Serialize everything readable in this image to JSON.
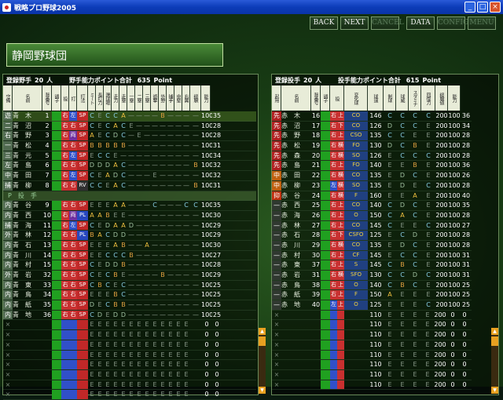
{
  "window": {
    "title": "戦略プロ野球2005"
  },
  "toolbar": {
    "back": "BACK",
    "next": "NEXT",
    "cancel": "CANCEL",
    "data": "DATA",
    "config": "CONFIG",
    "menu": "MENU"
  },
  "team": {
    "name": "静岡野球団"
  },
  "batters": {
    "label_registered": "登録野手",
    "count": "20",
    "unit": "人",
    "points_label": "野手能力ポイント合計",
    "points": "635",
    "points_unit": "Point",
    "headers": [
      "守備",
      "名前",
      "背番号",
      "調子",
      "投",
      "打",
      "打法",
      "ミート",
      "長打力",
      "選球眼",
      "走力",
      "走塁",
      "一塁",
      "二塁",
      "三塁",
      "遊撃",
      "外野",
      "捕手",
      "中堅",
      "右翼",
      "経験",
      "能力"
    ],
    "rows": [
      {
        "pos": "遊",
        "name": "青　木",
        "no": "1",
        "bat": "右",
        "hand": "左",
        "style": "SP",
        "g": [
          "C",
          "E",
          "C",
          "C",
          "A",
          "—",
          "—",
          "—",
          "—",
          "B",
          "—",
          "—",
          "—",
          "—"
        ],
        "exp": "100",
        "ab": "35"
      },
      {
        "pos": "二",
        "name": "青　沼",
        "no": "2",
        "bat": "右",
        "hand": "右",
        "style": "SP",
        "g": [
          "C",
          "E",
          "C",
          "A",
          "C",
          "E",
          "—",
          "—",
          "—",
          "—",
          "—",
          "—",
          "—",
          "—"
        ],
        "exp": "100",
        "ab": "28"
      },
      {
        "pos": "右",
        "name": "青　野",
        "no": "3",
        "bat": "右",
        "hand": "両",
        "style": "SP",
        "g": [
          "A",
          "E",
          "C",
          "D",
          "C",
          "—",
          "E",
          "—",
          "—",
          "—",
          "—",
          "—",
          "—",
          "—"
        ],
        "exp": "100",
        "ab": "28"
      },
      {
        "pos": "一",
        "name": "青　松",
        "no": "4",
        "bat": "右",
        "hand": "右",
        "style": "SP",
        "g": [
          "B",
          "B",
          "B",
          "B",
          "B",
          "—",
          "—",
          "—",
          "—",
          "—",
          "—",
          "—",
          "—",
          "—"
        ],
        "exp": "100",
        "ab": "31"
      },
      {
        "pos": "三",
        "name": "青　元",
        "no": "5",
        "bat": "右",
        "hand": "左",
        "style": "SP",
        "g": [
          "E",
          "C",
          "C",
          "E",
          "—",
          "—",
          "—",
          "—",
          "—",
          "—",
          "—",
          "—",
          "—",
          "—"
        ],
        "exp": "100",
        "ab": "34"
      },
      {
        "pos": "左",
        "name": "青　島",
        "no": "6",
        "bat": "右",
        "hand": "右",
        "style": "SP",
        "g": [
          "D",
          "D",
          "D",
          "A",
          "C",
          "—",
          "—",
          "—",
          "—",
          "—",
          "—",
          "—",
          "—",
          "B"
        ],
        "exp": "100",
        "ab": "32"
      },
      {
        "pos": "中",
        "name": "青　田",
        "no": "7",
        "bat": "右",
        "hand": "左",
        "style": "SP",
        "g": [
          "C",
          "E",
          "A",
          "D",
          "C",
          "—",
          "—",
          "—",
          "E",
          "—",
          "—",
          "—",
          "—",
          "—"
        ],
        "exp": "100",
        "ab": "32"
      },
      {
        "pos": "捕",
        "name": "青　柳",
        "no": "8",
        "bat": "右",
        "hand": "右",
        "style": "RV",
        "g": [
          "C",
          "C",
          "E",
          "A",
          "C",
          "—",
          "—",
          "—",
          "—",
          "—",
          "—",
          "—",
          "—",
          "B"
        ],
        "exp": "100",
        "ab": "31"
      },
      {
        "section": "P　投　手"
      },
      {
        "pos": "内",
        "name": "青　谷",
        "no": "9",
        "bat": "右",
        "hand": "右",
        "style": "SP",
        "g": [
          "E",
          "E",
          "E",
          "A",
          "A",
          "—",
          "—",
          "—",
          "C",
          "—",
          "—",
          "—",
          "C",
          "C"
        ],
        "exp": "100",
        "ab": "35"
      },
      {
        "pos": "内",
        "name": "青　西",
        "no": "10",
        "bat": "右",
        "hand": "両",
        "style": "PL",
        "g": [
          "A",
          "A",
          "B",
          "E",
          "E",
          "—",
          "—",
          "—",
          "—",
          "—",
          "—",
          "—",
          "—",
          "—"
        ],
        "exp": "100",
        "ab": "30"
      },
      {
        "pos": "捕",
        "name": "青　海",
        "no": "11",
        "bat": "右",
        "hand": "左",
        "style": "SP",
        "g": [
          "C",
          "E",
          "D",
          "A",
          "A",
          "D",
          "—",
          "—",
          "—",
          "—",
          "—",
          "—",
          "—",
          "—"
        ],
        "exp": "100",
        "ab": "29"
      },
      {
        "pos": "外",
        "name": "青　林",
        "no": "12",
        "bat": "右",
        "hand": "右",
        "style": "PL",
        "g": [
          "B",
          "A",
          "C",
          "D",
          "D",
          "—",
          "—",
          "—",
          "—",
          "—",
          "—",
          "—",
          "—",
          "—"
        ],
        "exp": "100",
        "ab": "29"
      },
      {
        "pos": "内",
        "name": "青　石",
        "no": "13",
        "bat": "右",
        "hand": "右",
        "style": "SP",
        "g": [
          "E",
          "E",
          "E",
          "A",
          "B",
          "—",
          "—",
          "A",
          "—",
          "—",
          "—",
          "—",
          "—",
          "—"
        ],
        "exp": "100",
        "ab": "30"
      },
      {
        "pos": "内",
        "name": "青　川",
        "no": "14",
        "bat": "右",
        "hand": "右",
        "style": "SP",
        "g": [
          "E",
          "E",
          "C",
          "C",
          "C",
          "B",
          "—",
          "—",
          "—",
          "—",
          "—",
          "—",
          "—",
          "—"
        ],
        "exp": "100",
        "ab": "27"
      },
      {
        "pos": "内",
        "name": "青　村",
        "no": "15",
        "bat": "右",
        "hand": "右",
        "style": "SP",
        "g": [
          "C",
          "E",
          "D",
          "D",
          "B",
          "—",
          "—",
          "—",
          "—",
          "—",
          "—",
          "—",
          "—",
          "—"
        ],
        "exp": "100",
        "ab": "28"
      },
      {
        "pos": "外",
        "name": "青　岩",
        "no": "32",
        "bat": "右",
        "hand": "右",
        "style": "SP",
        "g": [
          "C",
          "E",
          "C",
          "B",
          "E",
          "—",
          "—",
          "—",
          "—",
          "B",
          "—",
          "—",
          "—",
          "—"
        ],
        "exp": "100",
        "ab": "29"
      },
      {
        "pos": "内",
        "name": "青　東",
        "no": "33",
        "bat": "右",
        "hand": "右",
        "style": "SP",
        "g": [
          "C",
          "B",
          "C",
          "E",
          "C",
          "—",
          "—",
          "—",
          "—",
          "—",
          "—",
          "—",
          "—",
          "—"
        ],
        "exp": "100",
        "ab": "25"
      },
      {
        "pos": "内",
        "name": "青　鳥",
        "no": "34",
        "bat": "右",
        "hand": "右",
        "style": "SP",
        "g": [
          "E",
          "E",
          "E",
          "B",
          "C",
          "—",
          "—",
          "—",
          "—",
          "—",
          "—",
          "—",
          "—",
          "—"
        ],
        "exp": "100",
        "ab": "25"
      },
      {
        "pos": "内",
        "name": "青　紙",
        "no": "35",
        "bat": "右",
        "hand": "右",
        "style": "SP",
        "g": [
          "D",
          "E",
          "C",
          "B",
          "B",
          "—",
          "—",
          "—",
          "—",
          "—",
          "—",
          "—",
          "—",
          "—"
        ],
        "exp": "100",
        "ab": "25"
      },
      {
        "pos": "内",
        "name": "青　地",
        "no": "36",
        "bat": "右",
        "hand": "右",
        "style": "SP",
        "g": [
          "C",
          "D",
          "E",
          "D",
          "D",
          "—",
          "—",
          "—",
          "—",
          "—",
          "—",
          "—",
          "—",
          "—"
        ],
        "exp": "100",
        "ab": "25"
      }
    ],
    "empty_rows": 8,
    "empty_grades": "E",
    "empty_exp": "0",
    "empty_ab": "0"
  },
  "pitchers": {
    "label_registered": "登録投手",
    "count": "20",
    "unit": "人",
    "points_label": "投手能力ポイント合計",
    "points": "615",
    "points_unit": "Point",
    "headers": [
      "起用",
      "名前",
      "背番号",
      "調子",
      "投",
      "変化球",
      "球速",
      "制球",
      "球威",
      "スタミナ",
      "回復力",
      "経験値",
      "能力"
    ],
    "rows": [
      {
        "role": "先",
        "name": "赤　木",
        "no": "16",
        "hand": "右",
        "type": "上",
        "chg": "CO",
        "spd": "146",
        "g": [
          "C",
          "C",
          "C",
          "C"
        ],
        "sta": "200",
        "exp": "100",
        "ab": "36"
      },
      {
        "role": "先",
        "name": "赤　沼",
        "no": "17",
        "hand": "右",
        "type": "下",
        "chg": "CO",
        "spd": "126",
        "g": [
          "D",
          "C",
          "C",
          "E"
        ],
        "sta": "200",
        "exp": "100",
        "ab": "34"
      },
      {
        "role": "先",
        "name": "赤　野",
        "no": "18",
        "hand": "右",
        "type": "上",
        "chg": "CSO",
        "spd": "135",
        "g": [
          "C",
          "C",
          "E",
          "E"
        ],
        "sta": "200",
        "exp": "100",
        "ab": "28"
      },
      {
        "role": "先",
        "name": "赤　松",
        "no": "19",
        "hand": "右",
        "type": "横",
        "chg": "FO",
        "spd": "130",
        "g": [
          "D",
          "C",
          "B",
          "E"
        ],
        "sta": "200",
        "exp": "100",
        "ab": "28"
      },
      {
        "role": "先",
        "name": "赤　森",
        "no": "20",
        "hand": "右",
        "type": "横",
        "chg": "SO",
        "spd": "126",
        "g": [
          "E",
          "C",
          "C",
          "C"
        ],
        "sta": "200",
        "exp": "100",
        "ab": "28"
      },
      {
        "role": "先",
        "name": "赤　島",
        "no": "21",
        "hand": "右",
        "type": "上",
        "chg": "FO",
        "spd": "140",
        "g": [
          "E",
          "E",
          "B",
          "E"
        ],
        "sta": "200",
        "exp": "100",
        "ab": "36"
      },
      {
        "role": "中",
        "name": "赤　田",
        "no": "22",
        "hand": "右",
        "type": "横",
        "chg": "CO",
        "spd": "135",
        "g": [
          "E",
          "D",
          "C",
          "E"
        ],
        "sta": "200",
        "exp": "100",
        "ab": "26"
      },
      {
        "role": "中",
        "name": "赤　柳",
        "no": "23",
        "hand": "左",
        "type": "横",
        "chg": "SO",
        "spd": "135",
        "g": [
          "E",
          "D",
          "E",
          "C"
        ],
        "sta": "200",
        "exp": "100",
        "ab": "28"
      },
      {
        "role": "抑",
        "name": "赤　谷",
        "no": "24",
        "hand": "右",
        "type": "横",
        "chg": "F",
        "spd": "160",
        "g": [
          "E",
          "E",
          "A",
          "E"
        ],
        "sta": "200",
        "exp": "100",
        "ab": "40"
      },
      {
        "role": "—",
        "name": "赤　西",
        "no": "25",
        "hand": "右",
        "type": "上",
        "chg": "CO",
        "spd": "140",
        "g": [
          "C",
          "D",
          "C",
          "E"
        ],
        "sta": "200",
        "exp": "100",
        "ab": "35"
      },
      {
        "role": "—",
        "name": "赤　海",
        "no": "26",
        "hand": "右",
        "type": "上",
        "chg": "O",
        "spd": "150",
        "g": [
          "C",
          "A",
          "C",
          "E"
        ],
        "sta": "200",
        "exp": "100",
        "ab": "28"
      },
      {
        "role": "—",
        "name": "赤　林",
        "no": "27",
        "hand": "右",
        "type": "上",
        "chg": "CO",
        "spd": "145",
        "g": [
          "C",
          "E",
          "E",
          "C"
        ],
        "sta": "200",
        "exp": "100",
        "ab": "27"
      },
      {
        "role": "—",
        "name": "赤　石",
        "no": "28",
        "hand": "右",
        "type": "下",
        "chg": "CSFO",
        "spd": "125",
        "g": [
          "E",
          "C",
          "D",
          "E"
        ],
        "sta": "200",
        "exp": "100",
        "ab": "28"
      },
      {
        "role": "—",
        "name": "赤　川",
        "no": "29",
        "hand": "右",
        "type": "横",
        "chg": "CO",
        "spd": "135",
        "g": [
          "E",
          "D",
          "C",
          "E"
        ],
        "sta": "200",
        "exp": "100",
        "ab": "28"
      },
      {
        "role": "—",
        "name": "赤　村",
        "no": "30",
        "hand": "右",
        "type": "上",
        "chg": "CF",
        "spd": "145",
        "g": [
          "E",
          "C",
          "C",
          "E"
        ],
        "sta": "200",
        "exp": "100",
        "ab": "31"
      },
      {
        "role": "—",
        "name": "赤　東",
        "no": "37",
        "hand": "右",
        "type": "上",
        "chg": "S",
        "spd": "145",
        "g": [
          "C",
          "B",
          "C",
          "E"
        ],
        "sta": "200",
        "exp": "100",
        "ab": "31"
      },
      {
        "role": "—",
        "name": "赤　岩",
        "no": "31",
        "hand": "右",
        "type": "横",
        "chg": "SFO",
        "spd": "130",
        "g": [
          "C",
          "C",
          "D",
          "C"
        ],
        "sta": "200",
        "exp": "100",
        "ab": "31"
      },
      {
        "role": "—",
        "name": "赤　鳥",
        "no": "38",
        "hand": "右",
        "type": "上",
        "chg": "O",
        "spd": "140",
        "g": [
          "C",
          "B",
          "C",
          "E"
        ],
        "sta": "200",
        "exp": "100",
        "ab": "25"
      },
      {
        "role": "—",
        "name": "赤　紙",
        "no": "39",
        "hand": "右",
        "type": "上",
        "chg": "F",
        "spd": "150",
        "g": [
          "A",
          "E",
          "E",
          "E"
        ],
        "sta": "200",
        "exp": "100",
        "ab": "25"
      },
      {
        "role": "—",
        "name": "赤　地",
        "no": "40",
        "hand": "左",
        "type": "上",
        "chg": "O",
        "spd": "125",
        "g": [
          "E",
          "E",
          "E",
          "C"
        ],
        "sta": "200",
        "exp": "100",
        "ab": "25"
      }
    ],
    "empty_rows": 8,
    "empty_spd": "110",
    "empty_grade": "E",
    "empty_sta": "200",
    "empty_exp": "0",
    "empty_ab": "0"
  },
  "colors": {
    "accent": "#e8a020",
    "panel_border": "#6a8a5a",
    "highlight": "#c0e0a0"
  }
}
